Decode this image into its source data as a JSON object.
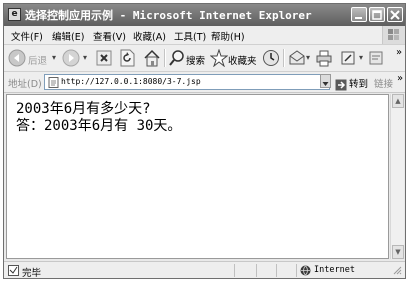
{
  "window": {
    "title": "选择控制应用示例 - Microsoft Internet Explorer"
  },
  "menu": {
    "items": [
      "文件(F)",
      "编辑(E)",
      "查看(V)",
      "收藏(A)",
      "工具(T)",
      "帮助(H)"
    ]
  },
  "toolbar": {
    "back_label": "后退",
    "search_label": "搜索",
    "favorites_label": "收藏夹",
    "overflow": "»"
  },
  "address": {
    "label": "地址(D)",
    "url": "http://127.0.0.1:8080/3-7.jsp",
    "go_label": "转到",
    "links_label": "链接",
    "overflow": "»"
  },
  "page": {
    "question": "2003年6月有多少天?",
    "answer": "答：2003年6月有 30天。"
  },
  "status": {
    "text": "完毕",
    "zone": "Internet"
  },
  "colors": {
    "titlebar": "#6e6e6e",
    "chrome": "#eeeeee",
    "content_bg": "#ffffff"
  }
}
